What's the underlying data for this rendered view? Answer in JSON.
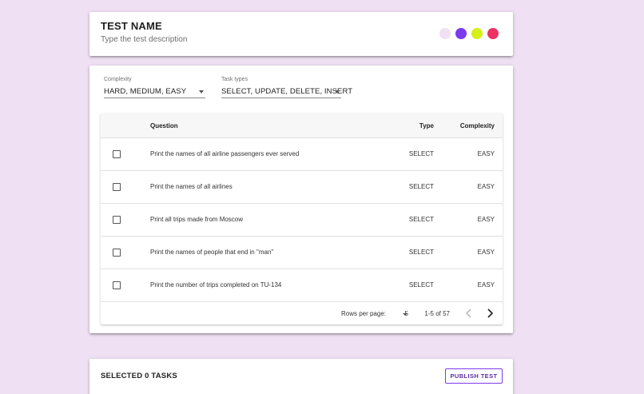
{
  "header": {
    "title": "TEST NAME",
    "description": "Type the test description",
    "color_dots": [
      "#efe0f3",
      "#7c3aed",
      "#d6f01a",
      "#ec3363"
    ]
  },
  "filters": {
    "complexity": {
      "label": "Complexity",
      "value": "HARD, MEDIUM, EASY"
    },
    "task_types": {
      "label": "Task types",
      "value": "SELECT, UPDATE, DELETE, INSERT"
    }
  },
  "table": {
    "columns": [
      "Question",
      "Type",
      "Complexity"
    ],
    "rows": [
      {
        "question": "Print the names of all airline passengers ever served",
        "type": "SELECT",
        "complexity": "EASY"
      },
      {
        "question": "Print the names of all airlines",
        "type": "SELECT",
        "complexity": "EASY"
      },
      {
        "question": "Print all trips made from Moscow",
        "type": "SELECT",
        "complexity": "EASY"
      },
      {
        "question": "Print the names of people that end in \"man\"",
        "type": "SELECT",
        "complexity": "EASY"
      },
      {
        "question": "Print the number of trips completed on TU-134",
        "type": "SELECT",
        "complexity": "EASY"
      }
    ]
  },
  "pagination": {
    "rows_per_page_label": "Rows per page:",
    "rows_per_page": "5",
    "range": "1-5 of 57"
  },
  "footer": {
    "selected_label": "SELECTED 0 TASKS",
    "publish_label": "PUBLISH TEST"
  }
}
